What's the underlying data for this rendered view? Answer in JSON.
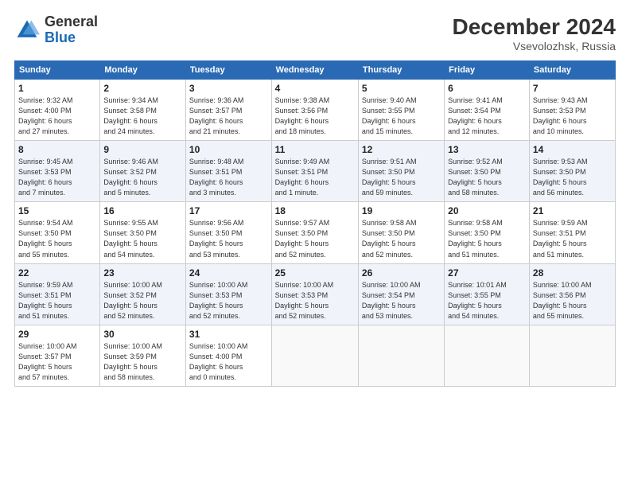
{
  "header": {
    "logo_general": "General",
    "logo_blue": "Blue",
    "month": "December 2024",
    "location": "Vsevolozhsk, Russia"
  },
  "weekdays": [
    "Sunday",
    "Monday",
    "Tuesday",
    "Wednesday",
    "Thursday",
    "Friday",
    "Saturday"
  ],
  "weeks": [
    [
      {
        "day": "1",
        "info": "Sunrise: 9:32 AM\nSunset: 4:00 PM\nDaylight: 6 hours\nand 27 minutes."
      },
      {
        "day": "2",
        "info": "Sunrise: 9:34 AM\nSunset: 3:58 PM\nDaylight: 6 hours\nand 24 minutes."
      },
      {
        "day": "3",
        "info": "Sunrise: 9:36 AM\nSunset: 3:57 PM\nDaylight: 6 hours\nand 21 minutes."
      },
      {
        "day": "4",
        "info": "Sunrise: 9:38 AM\nSunset: 3:56 PM\nDaylight: 6 hours\nand 18 minutes."
      },
      {
        "day": "5",
        "info": "Sunrise: 9:40 AM\nSunset: 3:55 PM\nDaylight: 6 hours\nand 15 minutes."
      },
      {
        "day": "6",
        "info": "Sunrise: 9:41 AM\nSunset: 3:54 PM\nDaylight: 6 hours\nand 12 minutes."
      },
      {
        "day": "7",
        "info": "Sunrise: 9:43 AM\nSunset: 3:53 PM\nDaylight: 6 hours\nand 10 minutes."
      }
    ],
    [
      {
        "day": "8",
        "info": "Sunrise: 9:45 AM\nSunset: 3:53 PM\nDaylight: 6 hours\nand 7 minutes."
      },
      {
        "day": "9",
        "info": "Sunrise: 9:46 AM\nSunset: 3:52 PM\nDaylight: 6 hours\nand 5 minutes."
      },
      {
        "day": "10",
        "info": "Sunrise: 9:48 AM\nSunset: 3:51 PM\nDaylight: 6 hours\nand 3 minutes."
      },
      {
        "day": "11",
        "info": "Sunrise: 9:49 AM\nSunset: 3:51 PM\nDaylight: 6 hours\nand 1 minute."
      },
      {
        "day": "12",
        "info": "Sunrise: 9:51 AM\nSunset: 3:50 PM\nDaylight: 5 hours\nand 59 minutes."
      },
      {
        "day": "13",
        "info": "Sunrise: 9:52 AM\nSunset: 3:50 PM\nDaylight: 5 hours\nand 58 minutes."
      },
      {
        "day": "14",
        "info": "Sunrise: 9:53 AM\nSunset: 3:50 PM\nDaylight: 5 hours\nand 56 minutes."
      }
    ],
    [
      {
        "day": "15",
        "info": "Sunrise: 9:54 AM\nSunset: 3:50 PM\nDaylight: 5 hours\nand 55 minutes."
      },
      {
        "day": "16",
        "info": "Sunrise: 9:55 AM\nSunset: 3:50 PM\nDaylight: 5 hours\nand 54 minutes."
      },
      {
        "day": "17",
        "info": "Sunrise: 9:56 AM\nSunset: 3:50 PM\nDaylight: 5 hours\nand 53 minutes."
      },
      {
        "day": "18",
        "info": "Sunrise: 9:57 AM\nSunset: 3:50 PM\nDaylight: 5 hours\nand 52 minutes."
      },
      {
        "day": "19",
        "info": "Sunrise: 9:58 AM\nSunset: 3:50 PM\nDaylight: 5 hours\nand 52 minutes."
      },
      {
        "day": "20",
        "info": "Sunrise: 9:58 AM\nSunset: 3:50 PM\nDaylight: 5 hours\nand 51 minutes."
      },
      {
        "day": "21",
        "info": "Sunrise: 9:59 AM\nSunset: 3:51 PM\nDaylight: 5 hours\nand 51 minutes."
      }
    ],
    [
      {
        "day": "22",
        "info": "Sunrise: 9:59 AM\nSunset: 3:51 PM\nDaylight: 5 hours\nand 51 minutes."
      },
      {
        "day": "23",
        "info": "Sunrise: 10:00 AM\nSunset: 3:52 PM\nDaylight: 5 hours\nand 52 minutes."
      },
      {
        "day": "24",
        "info": "Sunrise: 10:00 AM\nSunset: 3:53 PM\nDaylight: 5 hours\nand 52 minutes."
      },
      {
        "day": "25",
        "info": "Sunrise: 10:00 AM\nSunset: 3:53 PM\nDaylight: 5 hours\nand 52 minutes."
      },
      {
        "day": "26",
        "info": "Sunrise: 10:00 AM\nSunset: 3:54 PM\nDaylight: 5 hours\nand 53 minutes."
      },
      {
        "day": "27",
        "info": "Sunrise: 10:01 AM\nSunset: 3:55 PM\nDaylight: 5 hours\nand 54 minutes."
      },
      {
        "day": "28",
        "info": "Sunrise: 10:00 AM\nSunset: 3:56 PM\nDaylight: 5 hours\nand 55 minutes."
      }
    ],
    [
      {
        "day": "29",
        "info": "Sunrise: 10:00 AM\nSunset: 3:57 PM\nDaylight: 5 hours\nand 57 minutes."
      },
      {
        "day": "30",
        "info": "Sunrise: 10:00 AM\nSunset: 3:59 PM\nDaylight: 5 hours\nand 58 minutes."
      },
      {
        "day": "31",
        "info": "Sunrise: 10:00 AM\nSunset: 4:00 PM\nDaylight: 6 hours\nand 0 minutes."
      },
      null,
      null,
      null,
      null
    ]
  ]
}
